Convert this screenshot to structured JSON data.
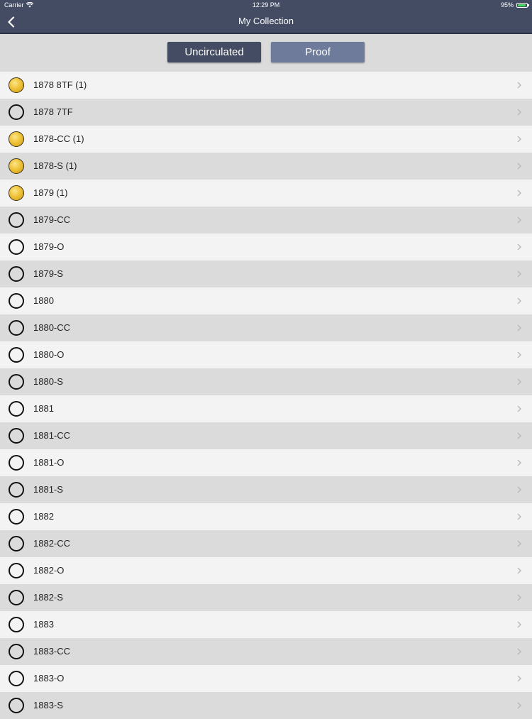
{
  "status_bar": {
    "carrier": "Carrier",
    "time": "12:29 PM",
    "battery": "95%",
    "battery_level": 0.95,
    "battery_color": "#4cd964"
  },
  "nav": {
    "title": "My Collection",
    "back_icon": "chevron-left-icon"
  },
  "segments": {
    "uncirculated": "Uncirculated",
    "proof": "Proof",
    "selected": "uncirculated"
  },
  "colors": {
    "nav_bg": "#434c63",
    "segment_selected": "#434c63",
    "segment_unselected": "#6e7b9b",
    "coin_gold": "#f0c337"
  },
  "coins": [
    {
      "label": "1878 8TF (1)",
      "owned": true
    },
    {
      "label": "1878 7TF",
      "owned": false
    },
    {
      "label": "1878-CC (1)",
      "owned": true
    },
    {
      "label": "1878-S (1)",
      "owned": true
    },
    {
      "label": "1879 (1)",
      "owned": true
    },
    {
      "label": "1879-CC",
      "owned": false
    },
    {
      "label": "1879-O",
      "owned": false
    },
    {
      "label": "1879-S",
      "owned": false
    },
    {
      "label": "1880",
      "owned": false
    },
    {
      "label": "1880-CC",
      "owned": false
    },
    {
      "label": "1880-O",
      "owned": false
    },
    {
      "label": "1880-S",
      "owned": false
    },
    {
      "label": "1881",
      "owned": false
    },
    {
      "label": "1881-CC",
      "owned": false
    },
    {
      "label": "1881-O",
      "owned": false
    },
    {
      "label": "1881-S",
      "owned": false
    },
    {
      "label": "1882",
      "owned": false
    },
    {
      "label": "1882-CC",
      "owned": false
    },
    {
      "label": "1882-O",
      "owned": false
    },
    {
      "label": "1882-S",
      "owned": false
    },
    {
      "label": "1883",
      "owned": false
    },
    {
      "label": "1883-CC",
      "owned": false
    },
    {
      "label": "1883-O",
      "owned": false
    },
    {
      "label": "1883-S",
      "owned": false
    }
  ]
}
